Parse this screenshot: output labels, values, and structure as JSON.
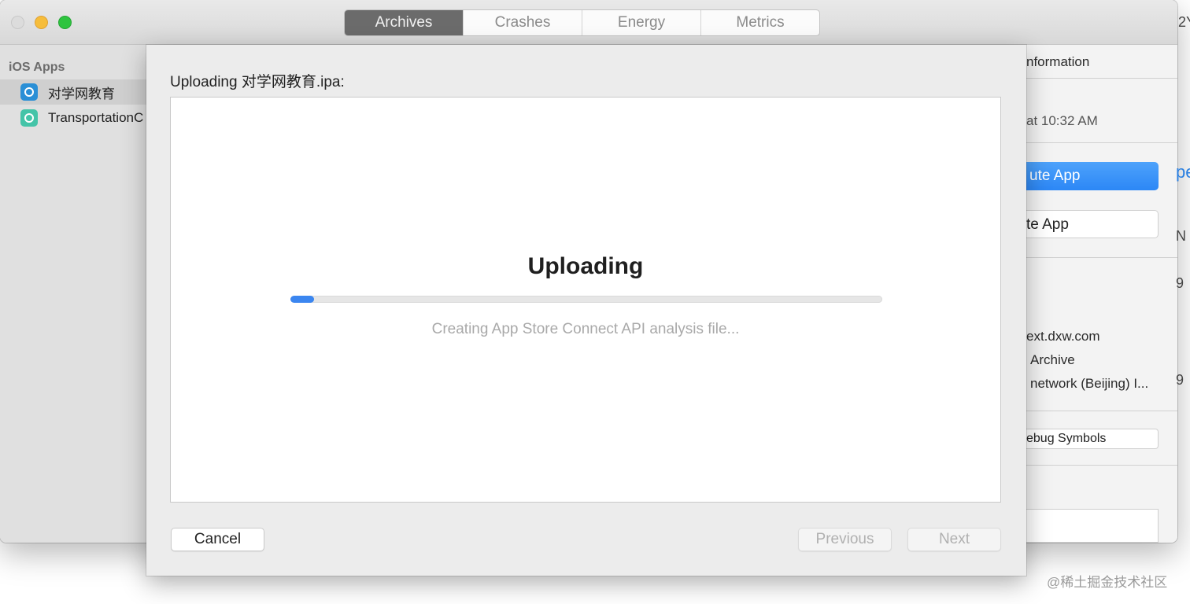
{
  "window": {
    "tabs": [
      {
        "label": "Archives",
        "active": true
      },
      {
        "label": "Crashes",
        "active": false
      },
      {
        "label": "Energy",
        "active": false
      },
      {
        "label": "Metrics",
        "active": false
      }
    ]
  },
  "sidebar": {
    "header": "iOS Apps",
    "items": [
      {
        "label": "对学网教育",
        "selected": true,
        "icon": "app-icon-blue"
      },
      {
        "label": "TransportationC",
        "selected": false,
        "icon": "app-icon-teal"
      }
    ]
  },
  "right_panel": {
    "information": "nformation",
    "time": "at 10:32 AM",
    "distribute_button": "ute App",
    "validate_button": "te App",
    "identifier": "ext.dxw.com",
    "type": "Archive",
    "team": "network (Beijing) I...",
    "debug_button": "ebug Symbols"
  },
  "edge_fragments": {
    "top": "2Y",
    "link": "pe",
    "n": "N",
    "nine_a": "9",
    "nine_b": "9"
  },
  "sheet": {
    "title": "Uploading 对学网教育.ipa:",
    "heading": "Uploading",
    "status": "Creating App Store Connect API analysis file...",
    "progress": 0.04,
    "buttons": {
      "cancel": "Cancel",
      "previous": "Previous",
      "next": "Next"
    }
  },
  "watermark": "@稀土掘金技术社区",
  "colors": {
    "accent": "#3b86f0",
    "primary_button": "#2c87f6"
  }
}
